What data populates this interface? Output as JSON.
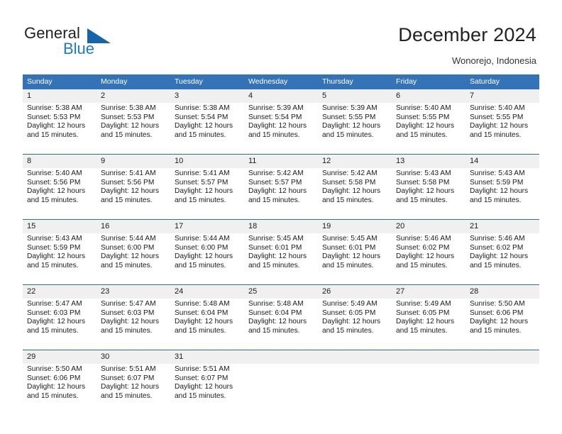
{
  "brand": {
    "name_part1": "General",
    "name_part2": "Blue",
    "accent_color": "#1f7ac4",
    "triangle_color": "#1565a8"
  },
  "header": {
    "title": "December 2024",
    "subtitle": "Wonorejo, Indonesia"
  },
  "calendar": {
    "header_bg": "#3573b9",
    "daynum_bg": "#f0f0f0",
    "weekday_headers": [
      "Sunday",
      "Monday",
      "Tuesday",
      "Wednesday",
      "Thursday",
      "Friday",
      "Saturday"
    ],
    "weeks": [
      [
        {
          "day": "1",
          "sunrise": "Sunrise: 5:38 AM",
          "sunset": "Sunset: 5:53 PM",
          "daylight_line1": "Daylight: 12 hours",
          "daylight_line2": "and 15 minutes."
        },
        {
          "day": "2",
          "sunrise": "Sunrise: 5:38 AM",
          "sunset": "Sunset: 5:53 PM",
          "daylight_line1": "Daylight: 12 hours",
          "daylight_line2": "and 15 minutes."
        },
        {
          "day": "3",
          "sunrise": "Sunrise: 5:38 AM",
          "sunset": "Sunset: 5:54 PM",
          "daylight_line1": "Daylight: 12 hours",
          "daylight_line2": "and 15 minutes."
        },
        {
          "day": "4",
          "sunrise": "Sunrise: 5:39 AM",
          "sunset": "Sunset: 5:54 PM",
          "daylight_line1": "Daylight: 12 hours",
          "daylight_line2": "and 15 minutes."
        },
        {
          "day": "5",
          "sunrise": "Sunrise: 5:39 AM",
          "sunset": "Sunset: 5:55 PM",
          "daylight_line1": "Daylight: 12 hours",
          "daylight_line2": "and 15 minutes."
        },
        {
          "day": "6",
          "sunrise": "Sunrise: 5:40 AM",
          "sunset": "Sunset: 5:55 PM",
          "daylight_line1": "Daylight: 12 hours",
          "daylight_line2": "and 15 minutes."
        },
        {
          "day": "7",
          "sunrise": "Sunrise: 5:40 AM",
          "sunset": "Sunset: 5:55 PM",
          "daylight_line1": "Daylight: 12 hours",
          "daylight_line2": "and 15 minutes."
        }
      ],
      [
        {
          "day": "8",
          "sunrise": "Sunrise: 5:40 AM",
          "sunset": "Sunset: 5:56 PM",
          "daylight_line1": "Daylight: 12 hours",
          "daylight_line2": "and 15 minutes."
        },
        {
          "day": "9",
          "sunrise": "Sunrise: 5:41 AM",
          "sunset": "Sunset: 5:56 PM",
          "daylight_line1": "Daylight: 12 hours",
          "daylight_line2": "and 15 minutes."
        },
        {
          "day": "10",
          "sunrise": "Sunrise: 5:41 AM",
          "sunset": "Sunset: 5:57 PM",
          "daylight_line1": "Daylight: 12 hours",
          "daylight_line2": "and 15 minutes."
        },
        {
          "day": "11",
          "sunrise": "Sunrise: 5:42 AM",
          "sunset": "Sunset: 5:57 PM",
          "daylight_line1": "Daylight: 12 hours",
          "daylight_line2": "and 15 minutes."
        },
        {
          "day": "12",
          "sunrise": "Sunrise: 5:42 AM",
          "sunset": "Sunset: 5:58 PM",
          "daylight_line1": "Daylight: 12 hours",
          "daylight_line2": "and 15 minutes."
        },
        {
          "day": "13",
          "sunrise": "Sunrise: 5:43 AM",
          "sunset": "Sunset: 5:58 PM",
          "daylight_line1": "Daylight: 12 hours",
          "daylight_line2": "and 15 minutes."
        },
        {
          "day": "14",
          "sunrise": "Sunrise: 5:43 AM",
          "sunset": "Sunset: 5:59 PM",
          "daylight_line1": "Daylight: 12 hours",
          "daylight_line2": "and 15 minutes."
        }
      ],
      [
        {
          "day": "15",
          "sunrise": "Sunrise: 5:43 AM",
          "sunset": "Sunset: 5:59 PM",
          "daylight_line1": "Daylight: 12 hours",
          "daylight_line2": "and 15 minutes."
        },
        {
          "day": "16",
          "sunrise": "Sunrise: 5:44 AM",
          "sunset": "Sunset: 6:00 PM",
          "daylight_line1": "Daylight: 12 hours",
          "daylight_line2": "and 15 minutes."
        },
        {
          "day": "17",
          "sunrise": "Sunrise: 5:44 AM",
          "sunset": "Sunset: 6:00 PM",
          "daylight_line1": "Daylight: 12 hours",
          "daylight_line2": "and 15 minutes."
        },
        {
          "day": "18",
          "sunrise": "Sunrise: 5:45 AM",
          "sunset": "Sunset: 6:01 PM",
          "daylight_line1": "Daylight: 12 hours",
          "daylight_line2": "and 15 minutes."
        },
        {
          "day": "19",
          "sunrise": "Sunrise: 5:45 AM",
          "sunset": "Sunset: 6:01 PM",
          "daylight_line1": "Daylight: 12 hours",
          "daylight_line2": "and 15 minutes."
        },
        {
          "day": "20",
          "sunrise": "Sunrise: 5:46 AM",
          "sunset": "Sunset: 6:02 PM",
          "daylight_line1": "Daylight: 12 hours",
          "daylight_line2": "and 15 minutes."
        },
        {
          "day": "21",
          "sunrise": "Sunrise: 5:46 AM",
          "sunset": "Sunset: 6:02 PM",
          "daylight_line1": "Daylight: 12 hours",
          "daylight_line2": "and 15 minutes."
        }
      ],
      [
        {
          "day": "22",
          "sunrise": "Sunrise: 5:47 AM",
          "sunset": "Sunset: 6:03 PM",
          "daylight_line1": "Daylight: 12 hours",
          "daylight_line2": "and 15 minutes."
        },
        {
          "day": "23",
          "sunrise": "Sunrise: 5:47 AM",
          "sunset": "Sunset: 6:03 PM",
          "daylight_line1": "Daylight: 12 hours",
          "daylight_line2": "and 15 minutes."
        },
        {
          "day": "24",
          "sunrise": "Sunrise: 5:48 AM",
          "sunset": "Sunset: 6:04 PM",
          "daylight_line1": "Daylight: 12 hours",
          "daylight_line2": "and 15 minutes."
        },
        {
          "day": "25",
          "sunrise": "Sunrise: 5:48 AM",
          "sunset": "Sunset: 6:04 PM",
          "daylight_line1": "Daylight: 12 hours",
          "daylight_line2": "and 15 minutes."
        },
        {
          "day": "26",
          "sunrise": "Sunrise: 5:49 AM",
          "sunset": "Sunset: 6:05 PM",
          "daylight_line1": "Daylight: 12 hours",
          "daylight_line2": "and 15 minutes."
        },
        {
          "day": "27",
          "sunrise": "Sunrise: 5:49 AM",
          "sunset": "Sunset: 6:05 PM",
          "daylight_line1": "Daylight: 12 hours",
          "daylight_line2": "and 15 minutes."
        },
        {
          "day": "28",
          "sunrise": "Sunrise: 5:50 AM",
          "sunset": "Sunset: 6:06 PM",
          "daylight_line1": "Daylight: 12 hours",
          "daylight_line2": "and 15 minutes."
        }
      ],
      [
        {
          "day": "29",
          "sunrise": "Sunrise: 5:50 AM",
          "sunset": "Sunset: 6:06 PM",
          "daylight_line1": "Daylight: 12 hours",
          "daylight_line2": "and 15 minutes."
        },
        {
          "day": "30",
          "sunrise": "Sunrise: 5:51 AM",
          "sunset": "Sunset: 6:07 PM",
          "daylight_line1": "Daylight: 12 hours",
          "daylight_line2": "and 15 minutes."
        },
        {
          "day": "31",
          "sunrise": "Sunrise: 5:51 AM",
          "sunset": "Sunset: 6:07 PM",
          "daylight_line1": "Daylight: 12 hours",
          "daylight_line2": "and 15 minutes."
        },
        {
          "day": "",
          "sunrise": "",
          "sunset": "",
          "daylight_line1": "",
          "daylight_line2": ""
        },
        {
          "day": "",
          "sunrise": "",
          "sunset": "",
          "daylight_line1": "",
          "daylight_line2": ""
        },
        {
          "day": "",
          "sunrise": "",
          "sunset": "",
          "daylight_line1": "",
          "daylight_line2": ""
        },
        {
          "day": "",
          "sunrise": "",
          "sunset": "",
          "daylight_line1": "",
          "daylight_line2": ""
        }
      ]
    ]
  }
}
